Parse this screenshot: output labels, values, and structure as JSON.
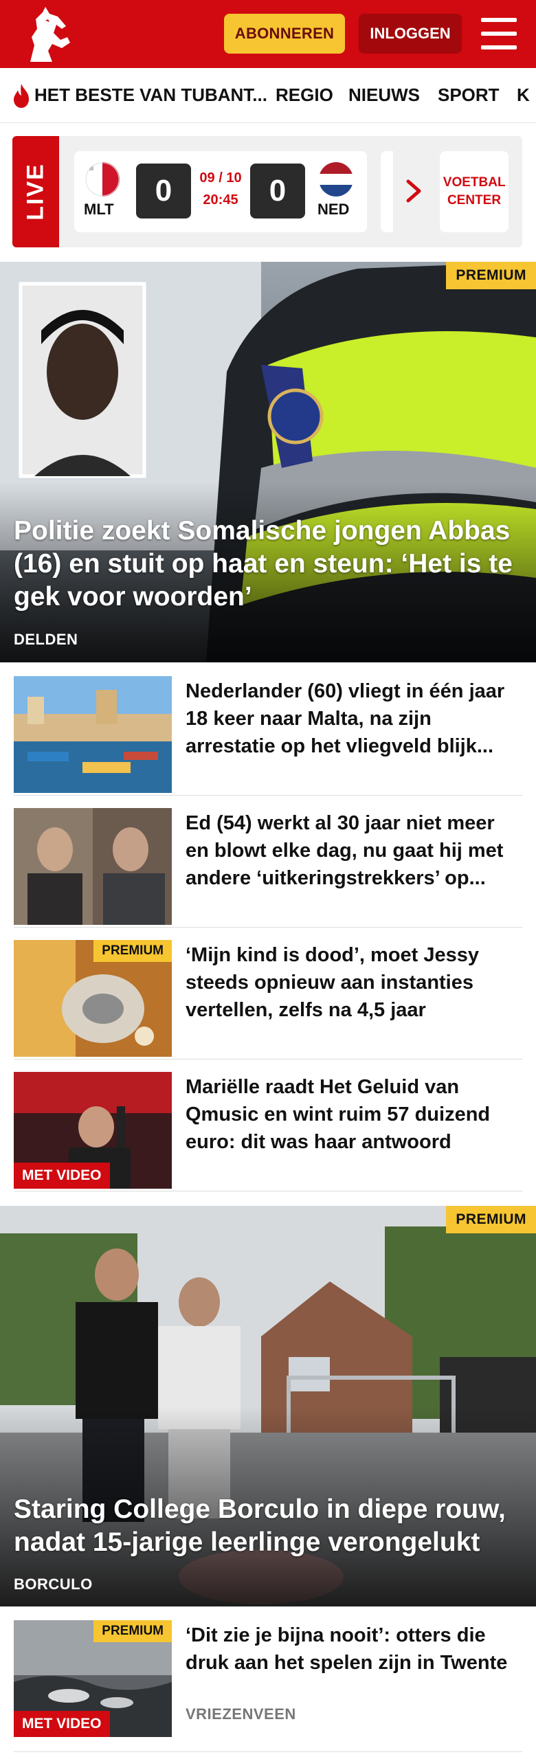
{
  "header": {
    "subscribe_label": "ABONNEREN",
    "login_label": "INLOGGEN"
  },
  "nav": {
    "items": [
      "HET BESTE VAN TUBANT...",
      "REGIO",
      "NIEUWS",
      "SPORT",
      "K"
    ]
  },
  "live": {
    "label": "LIVE",
    "home_code": "MLT",
    "home_score": "0",
    "date": "09 / 10",
    "time": "20:45",
    "away_code": "NED",
    "away_score": "0",
    "voetbal_label": "VOETBAL CENTER"
  },
  "hero1": {
    "badge": "PREMIUM",
    "title": "Politie zoekt Somalische jongen Abbas (16) en stuit op haat en steun: ‘Het is te gek voor woorden’",
    "place": "DELDEN"
  },
  "articles": [
    {
      "title": "Nederlander (60) vliegt in één jaar 18 keer naar Malta, na zijn arrestatie op het vliegveld blijk..."
    },
    {
      "title": "Ed (54) werkt al 30 jaar niet meer en blowt elke dag, nu gaat hij met andere ‘uitkeringstrekkers’ op..."
    },
    {
      "title": "‘Mijn kind is dood’, moet Jessy steeds opnieuw aan instanties vertellen, zelfs na 4,5 jaar",
      "badge": "PREMIUM"
    },
    {
      "title": "Mariëlle raadt Het Geluid van Qmusic en wint ruim 57 duizend euro: dit was haar antwoord",
      "video": "MET VIDEO"
    }
  ],
  "hero2": {
    "badge": "PREMIUM",
    "title": "Staring College Borculo in diepe rouw, nadat 15-jarige leerlinge verongelukt",
    "place": "BORCULO"
  },
  "articles2": [
    {
      "title": "‘Dit zie je bijna nooit’: otters die druk aan het spelen zijn in Twente",
      "place": "VRIEZENVEEN",
      "badge": "PREMIUM",
      "video": "MET VIDEO"
    }
  ],
  "colors": {
    "brand_red": "#d00a10",
    "premium_yellow": "#f6c531",
    "dark_red": "#a3080c"
  },
  "icons": [
    "horse-logo-icon",
    "menu-icon",
    "fire-icon",
    "chevron-right-icon"
  ]
}
